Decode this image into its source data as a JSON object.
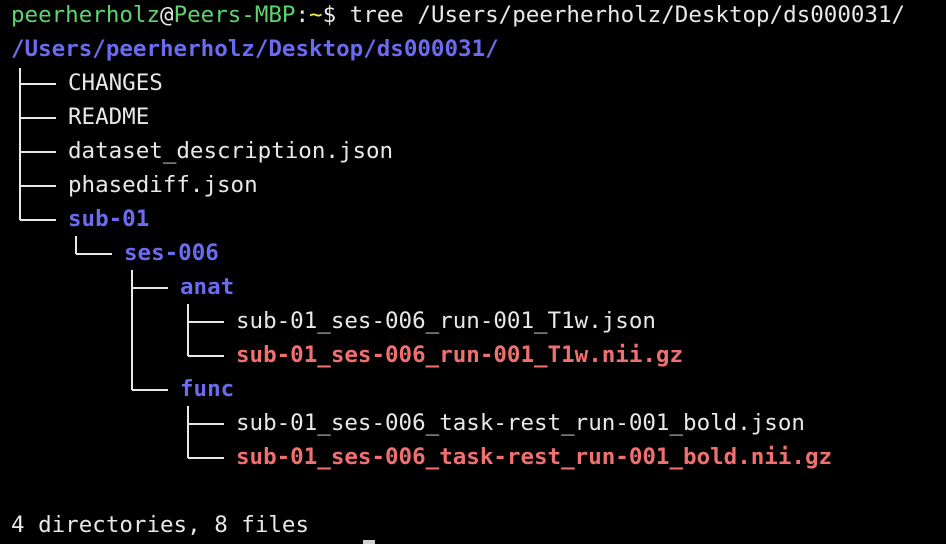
{
  "prompt": {
    "user": "peerherholz",
    "at": "@",
    "host": "Peers-MBP",
    "colon": ":",
    "path": "~",
    "dollar": "$",
    "command": "tree /Users/peerherholz/Desktop/ds000031/"
  },
  "tree": {
    "root": "/Users/peerherholz/Desktop/ds000031/",
    "entries": [
      {
        "name": "CHANGES",
        "kind": "file"
      },
      {
        "name": "README",
        "kind": "file"
      },
      {
        "name": "dataset_description.json",
        "kind": "file"
      },
      {
        "name": "phasediff.json",
        "kind": "file"
      },
      {
        "name": "sub-01",
        "kind": "dir"
      },
      {
        "name": "ses-006",
        "kind": "dir"
      },
      {
        "name": "anat",
        "kind": "dir"
      },
      {
        "name": "sub-01_ses-006_run-001_T1w.json",
        "kind": "file"
      },
      {
        "name": "sub-01_ses-006_run-001_T1w.nii.gz",
        "kind": "archive"
      },
      {
        "name": "func",
        "kind": "dir"
      },
      {
        "name": "sub-01_ses-006_task-rest_run-001_bold.json",
        "kind": "file"
      },
      {
        "name": "sub-01_ses-006_task-rest_run-001_bold.nii.gz",
        "kind": "archive"
      }
    ]
  },
  "summary": "4 directories, 8 files",
  "colors": {
    "background": "#000000",
    "prompt_user": "#5ed36f",
    "prompt_path": "#f2f05a",
    "directory": "#6b6bf0",
    "file": "#e8e8e8",
    "archive": "#f07070"
  }
}
